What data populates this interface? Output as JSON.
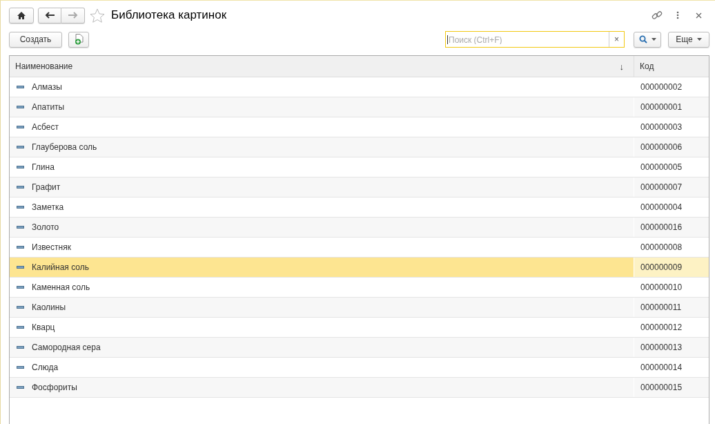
{
  "window": {
    "title": "Библиотека картинок"
  },
  "toolbar": {
    "create_button": "Создать",
    "search": {
      "placeholder": "Поиск (Ctrl+F)",
      "clear": "×"
    },
    "more_button": "Еще"
  },
  "table": {
    "columns": [
      {
        "label": "Наименование",
        "sort": "↓"
      },
      {
        "label": "Код"
      }
    ],
    "rows": [
      {
        "name": "Алмазы",
        "code": "000000002",
        "selected": false
      },
      {
        "name": "Апатиты",
        "code": "000000001",
        "selected": false
      },
      {
        "name": "Асбест",
        "code": "000000003",
        "selected": false
      },
      {
        "name": "Глауберова соль",
        "code": "000000006",
        "selected": false
      },
      {
        "name": "Глина",
        "code": "000000005",
        "selected": false
      },
      {
        "name": "Графит",
        "code": "000000007",
        "selected": false
      },
      {
        "name": "Заметка",
        "code": "000000004",
        "selected": false
      },
      {
        "name": "Золото",
        "code": "000000016",
        "selected": false
      },
      {
        "name": "Известняк",
        "code": "000000008",
        "selected": false
      },
      {
        "name": "Калийная соль",
        "code": "000000009",
        "selected": true
      },
      {
        "name": "Каменная соль",
        "code": "000000010",
        "selected": false
      },
      {
        "name": "Каолины",
        "code": "000000011",
        "selected": false
      },
      {
        "name": "Кварц",
        "code": "000000012",
        "selected": false
      },
      {
        "name": "Самородная сера",
        "code": "000000013",
        "selected": false
      },
      {
        "name": "Слюда",
        "code": "000000014",
        "selected": false
      },
      {
        "name": "Фосфориты",
        "code": "000000015",
        "selected": false
      }
    ]
  }
}
